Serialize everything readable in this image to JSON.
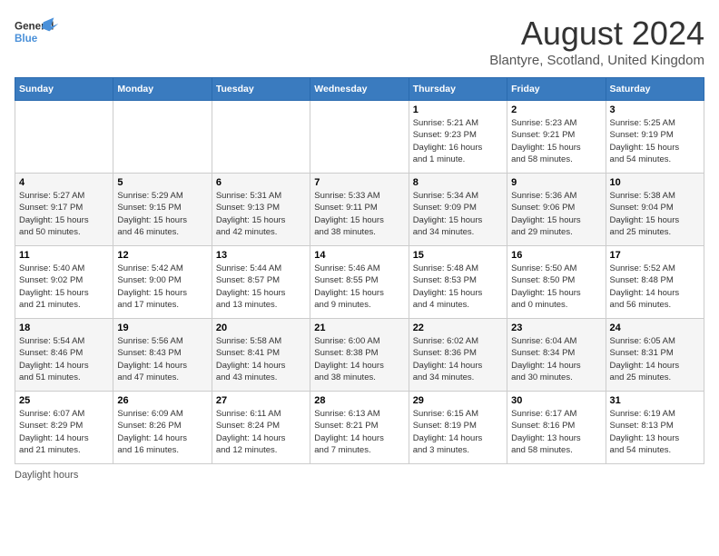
{
  "header": {
    "logo_general": "General",
    "logo_blue": "Blue",
    "main_title": "August 2024",
    "subtitle": "Blantyre, Scotland, United Kingdom"
  },
  "days_of_week": [
    "Sunday",
    "Monday",
    "Tuesday",
    "Wednesday",
    "Thursday",
    "Friday",
    "Saturday"
  ],
  "weeks": [
    [
      {
        "num": "",
        "info": ""
      },
      {
        "num": "",
        "info": ""
      },
      {
        "num": "",
        "info": ""
      },
      {
        "num": "",
        "info": ""
      },
      {
        "num": "1",
        "info": "Sunrise: 5:21 AM\nSunset: 9:23 PM\nDaylight: 16 hours\nand 1 minute."
      },
      {
        "num": "2",
        "info": "Sunrise: 5:23 AM\nSunset: 9:21 PM\nDaylight: 15 hours\nand 58 minutes."
      },
      {
        "num": "3",
        "info": "Sunrise: 5:25 AM\nSunset: 9:19 PM\nDaylight: 15 hours\nand 54 minutes."
      }
    ],
    [
      {
        "num": "4",
        "info": "Sunrise: 5:27 AM\nSunset: 9:17 PM\nDaylight: 15 hours\nand 50 minutes."
      },
      {
        "num": "5",
        "info": "Sunrise: 5:29 AM\nSunset: 9:15 PM\nDaylight: 15 hours\nand 46 minutes."
      },
      {
        "num": "6",
        "info": "Sunrise: 5:31 AM\nSunset: 9:13 PM\nDaylight: 15 hours\nand 42 minutes."
      },
      {
        "num": "7",
        "info": "Sunrise: 5:33 AM\nSunset: 9:11 PM\nDaylight: 15 hours\nand 38 minutes."
      },
      {
        "num": "8",
        "info": "Sunrise: 5:34 AM\nSunset: 9:09 PM\nDaylight: 15 hours\nand 34 minutes."
      },
      {
        "num": "9",
        "info": "Sunrise: 5:36 AM\nSunset: 9:06 PM\nDaylight: 15 hours\nand 29 minutes."
      },
      {
        "num": "10",
        "info": "Sunrise: 5:38 AM\nSunset: 9:04 PM\nDaylight: 15 hours\nand 25 minutes."
      }
    ],
    [
      {
        "num": "11",
        "info": "Sunrise: 5:40 AM\nSunset: 9:02 PM\nDaylight: 15 hours\nand 21 minutes."
      },
      {
        "num": "12",
        "info": "Sunrise: 5:42 AM\nSunset: 9:00 PM\nDaylight: 15 hours\nand 17 minutes."
      },
      {
        "num": "13",
        "info": "Sunrise: 5:44 AM\nSunset: 8:57 PM\nDaylight: 15 hours\nand 13 minutes."
      },
      {
        "num": "14",
        "info": "Sunrise: 5:46 AM\nSunset: 8:55 PM\nDaylight: 15 hours\nand 9 minutes."
      },
      {
        "num": "15",
        "info": "Sunrise: 5:48 AM\nSunset: 8:53 PM\nDaylight: 15 hours\nand 4 minutes."
      },
      {
        "num": "16",
        "info": "Sunrise: 5:50 AM\nSunset: 8:50 PM\nDaylight: 15 hours\nand 0 minutes."
      },
      {
        "num": "17",
        "info": "Sunrise: 5:52 AM\nSunset: 8:48 PM\nDaylight: 14 hours\nand 56 minutes."
      }
    ],
    [
      {
        "num": "18",
        "info": "Sunrise: 5:54 AM\nSunset: 8:46 PM\nDaylight: 14 hours\nand 51 minutes."
      },
      {
        "num": "19",
        "info": "Sunrise: 5:56 AM\nSunset: 8:43 PM\nDaylight: 14 hours\nand 47 minutes."
      },
      {
        "num": "20",
        "info": "Sunrise: 5:58 AM\nSunset: 8:41 PM\nDaylight: 14 hours\nand 43 minutes."
      },
      {
        "num": "21",
        "info": "Sunrise: 6:00 AM\nSunset: 8:38 PM\nDaylight: 14 hours\nand 38 minutes."
      },
      {
        "num": "22",
        "info": "Sunrise: 6:02 AM\nSunset: 8:36 PM\nDaylight: 14 hours\nand 34 minutes."
      },
      {
        "num": "23",
        "info": "Sunrise: 6:04 AM\nSunset: 8:34 PM\nDaylight: 14 hours\nand 30 minutes."
      },
      {
        "num": "24",
        "info": "Sunrise: 6:05 AM\nSunset: 8:31 PM\nDaylight: 14 hours\nand 25 minutes."
      }
    ],
    [
      {
        "num": "25",
        "info": "Sunrise: 6:07 AM\nSunset: 8:29 PM\nDaylight: 14 hours\nand 21 minutes."
      },
      {
        "num": "26",
        "info": "Sunrise: 6:09 AM\nSunset: 8:26 PM\nDaylight: 14 hours\nand 16 minutes."
      },
      {
        "num": "27",
        "info": "Sunrise: 6:11 AM\nSunset: 8:24 PM\nDaylight: 14 hours\nand 12 minutes."
      },
      {
        "num": "28",
        "info": "Sunrise: 6:13 AM\nSunset: 8:21 PM\nDaylight: 14 hours\nand 7 minutes."
      },
      {
        "num": "29",
        "info": "Sunrise: 6:15 AM\nSunset: 8:19 PM\nDaylight: 14 hours\nand 3 minutes."
      },
      {
        "num": "30",
        "info": "Sunrise: 6:17 AM\nSunset: 8:16 PM\nDaylight: 13 hours\nand 58 minutes."
      },
      {
        "num": "31",
        "info": "Sunrise: 6:19 AM\nSunset: 8:13 PM\nDaylight: 13 hours\nand 54 minutes."
      }
    ]
  ],
  "footer": {
    "daylight_label": "Daylight hours"
  }
}
